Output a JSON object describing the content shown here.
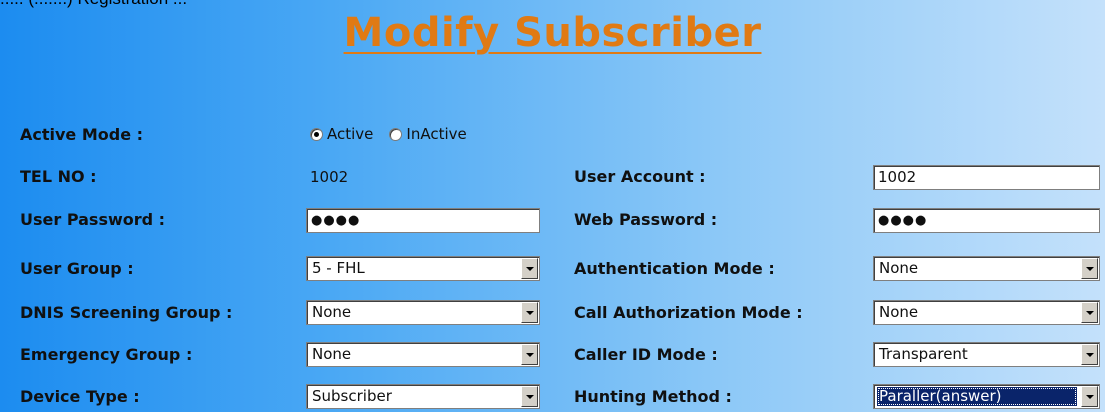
{
  "top_fragment": "..... (.......) Registration ...",
  "title": "Modify Subscriber",
  "active_mode": {
    "label": "Active Mode :",
    "options": [
      "Active",
      "InActive"
    ],
    "selected": "Active"
  },
  "tel_no": {
    "label": "TEL NO :",
    "value": "1002"
  },
  "user_account": {
    "label": "User Account :",
    "value": "1002"
  },
  "user_password": {
    "label": "User Password :",
    "value": "●●●●"
  },
  "web_password": {
    "label": "Web Password :",
    "value": "●●●●"
  },
  "user_group": {
    "label": "User Group :",
    "value": "5 - FHL"
  },
  "authentication_mode": {
    "label": "Authentication Mode :",
    "value": "None"
  },
  "dnis_screening_group": {
    "label": "DNIS Screening Group :",
    "value": "None"
  },
  "call_authorization_mode": {
    "label": "Call Authorization Mode :",
    "value": "None"
  },
  "emergency_group": {
    "label": "Emergency Group :",
    "value": "None"
  },
  "caller_id_mode": {
    "label": "Caller ID Mode :",
    "value": "Transparent"
  },
  "device_type": {
    "label": "Device Type :",
    "value": "Subscriber"
  },
  "hunting_method": {
    "label": "Hunting Method :",
    "value": "Paraller(answer)"
  },
  "colors": {
    "title": "#e07a14",
    "bg_left": "#1c8cf0",
    "bg_right": "#c4e1fb",
    "selection": "#0a246a"
  },
  "icons": {
    "dropdown": "chevron-down-icon",
    "radio": "radio-icon"
  }
}
